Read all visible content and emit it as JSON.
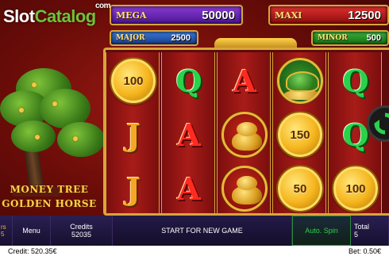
{
  "watermark": {
    "part1": "Slot",
    "part2": "Catalog",
    "suffix": "com"
  },
  "jackpots": {
    "mega": {
      "label": "MEGA",
      "value": "50000"
    },
    "maxi": {
      "label": "MAXI",
      "value": "12500"
    },
    "major": {
      "label": "MAJOR",
      "value": "2500"
    },
    "minor": {
      "label": "MINOR",
      "value": "500"
    }
  },
  "logo": {
    "line1": "MONEY TREE",
    "line2": "GOLDEN HORSE"
  },
  "reels": [
    [
      {
        "type": "coin",
        "value": "100"
      },
      {
        "type": "letter",
        "letter": "J",
        "color": "#f5a623"
      },
      {
        "type": "letter",
        "letter": "J",
        "color": "#f5a623"
      }
    ],
    [
      {
        "type": "letter",
        "letter": "Q",
        "color": "#2bd14a"
      },
      {
        "type": "letter",
        "letter": "A",
        "color": "#ff2a20"
      },
      {
        "type": "letter",
        "letter": "A",
        "color": "#ff2a20"
      }
    ],
    [
      {
        "type": "letter",
        "letter": "A",
        "color": "#ff2a20"
      },
      {
        "type": "frog-medal"
      },
      {
        "type": "frog-medal"
      }
    ],
    [
      {
        "type": "turtle-medal"
      },
      {
        "type": "coin",
        "value": "150"
      },
      {
        "type": "coin",
        "value": "50"
      }
    ],
    [
      {
        "type": "letter",
        "letter": "Q",
        "color": "#2bd14a"
      },
      {
        "type": "letter",
        "letter": "Q",
        "color": "#2bd14a"
      },
      {
        "type": "coin",
        "value": "100"
      }
    ]
  ],
  "controls": {
    "left_partial": "rs\n5",
    "menu": "Menu",
    "credits_label": "Credits",
    "credits_value": "52035",
    "start": "START FOR NEW GAME",
    "auto_spin": "Auto. Spin",
    "total_label": "Total",
    "total_value": "5"
  },
  "status": {
    "credit": "Credit: 520.35€",
    "bet": "Bet: 0.50€"
  },
  "icons": {
    "refresh": "refresh-arrows-icon"
  },
  "colors": {
    "mega": "#8a3bd6",
    "maxi": "#e03030",
    "major": "#3b7ad6",
    "minor": "#3bb13b",
    "gold": "#d9a53a",
    "auto_spin": "#2bd14a"
  }
}
